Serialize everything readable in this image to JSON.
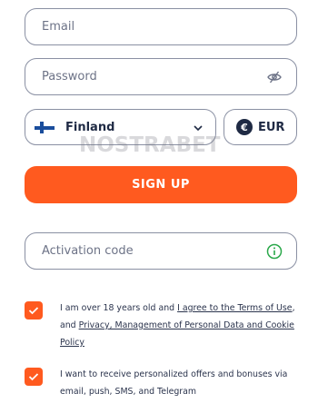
{
  "email": {
    "placeholder": "Email"
  },
  "password": {
    "placeholder": "Password",
    "icon": "eye-slash-icon"
  },
  "country": {
    "selected": "Finland",
    "flag": "finland-flag-icon",
    "icon": "chevron-down-icon"
  },
  "currency": {
    "symbol": "€",
    "code": "EUR"
  },
  "watermark": "NOSTRABET",
  "signup": {
    "label": "SIGN UP",
    "color": "#ff5a1f"
  },
  "activation": {
    "placeholder": "Activation code",
    "icon": "info-icon"
  },
  "terms": {
    "checked": true,
    "text_1": "I am over 18 years old and ",
    "link_1": "I agree to the Terms of Use",
    "text_2": ", and ",
    "link_2": "Privacy, Management of Personal Data and Cookie Policy"
  },
  "offers": {
    "checked": true,
    "text": "I want to receive personalized offers and bonuses via email, push, SMS, and Telegram"
  },
  "colors": {
    "accent": "#ff5a1f",
    "border": "#8a90a3",
    "info_green": "#2aa84a",
    "text": "#1f2a44"
  }
}
